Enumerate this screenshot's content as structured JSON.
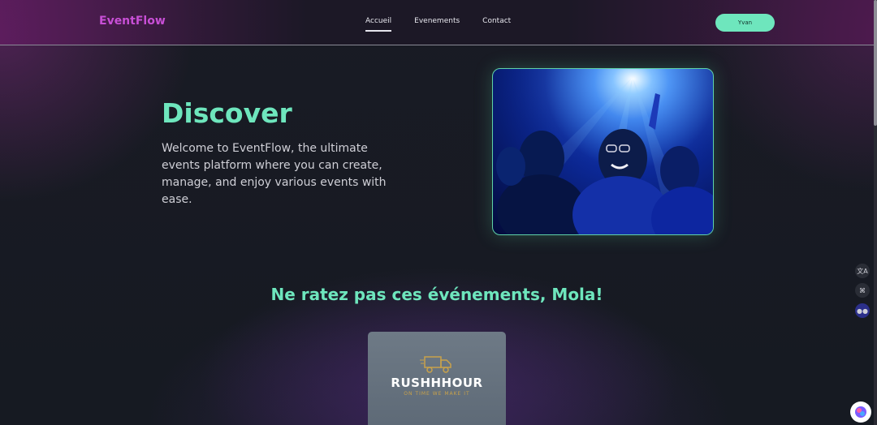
{
  "header": {
    "logo": "EventFlow",
    "nav": [
      {
        "label": "Accueil",
        "active": true
      },
      {
        "label": "Evenements",
        "active": false
      },
      {
        "label": "Contact",
        "active": false
      }
    ],
    "user_button": "Yvan"
  },
  "hero": {
    "title": "Discover",
    "text": "Welcome to EventFlow, the ultimate events platform where you can create, manage, and enjoy various events with ease.",
    "image_icon": "concert-crowd-image"
  },
  "events_section": {
    "title": "Ne ratez pas ces événements, Mola!",
    "card": {
      "brand": "RUSHHHOUR",
      "tagline": "ON TIME WE MAKE IT",
      "icon": "truck-icon"
    }
  },
  "side_tools": [
    "translate-icon",
    "apps-icon",
    "discord-icon"
  ],
  "colors": {
    "accent": "#6ee6bd",
    "logo": "#c84fd6",
    "background": "#141820"
  }
}
